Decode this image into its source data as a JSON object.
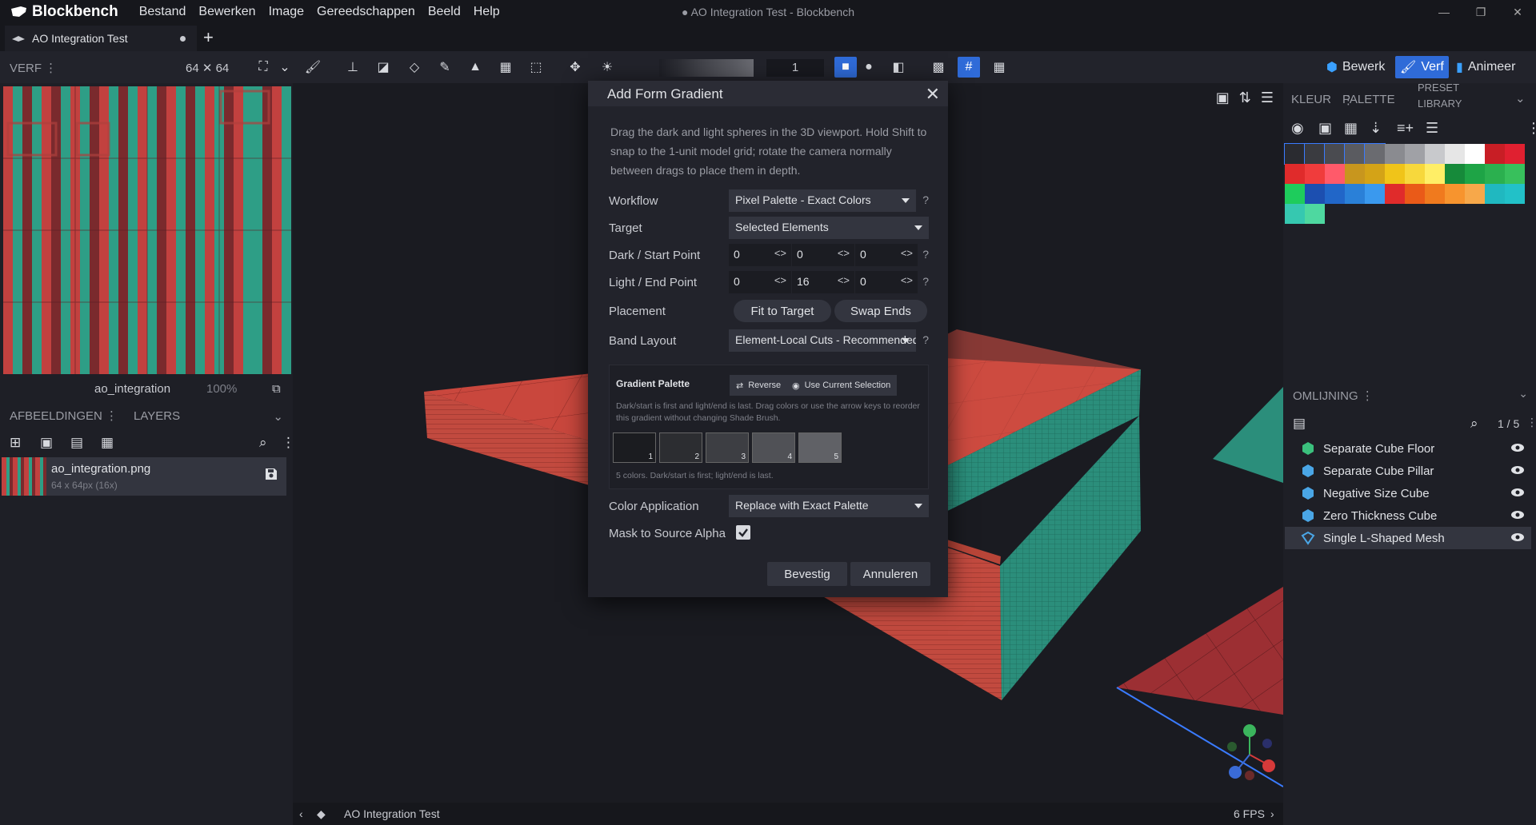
{
  "app": {
    "name": "Blockbench",
    "window_title": "AO Integration Test - Blockbench",
    "menu": [
      "Bestand",
      "Bewerken",
      "Image",
      "Gereedschappen",
      "Beeld",
      "Help"
    ]
  },
  "tabs": [
    {
      "label": "AO Integration Test"
    }
  ],
  "toolbar": {
    "mode_label": "VERF",
    "canvas_size": "64 ✕ 64",
    "brush_size": "1",
    "modes": [
      "Bewerk",
      "Verf",
      "Animeer"
    ]
  },
  "texture_preview": {
    "name": "ao_integration",
    "zoom": "100%"
  },
  "images_panel": {
    "tabs": [
      "AFBEELDINGEN",
      "LAYERS"
    ],
    "items": [
      {
        "name": "ao_integration.png",
        "sub": "64 x 64px (16x)"
      }
    ]
  },
  "dialog": {
    "title": "Add Form Gradient",
    "description": "Drag the dark and light spheres in the 3D viewport. Hold Shift to snap to the 1-unit model grid; rotate the camera normally between drags to place them in depth.",
    "workflow": {
      "label": "Workflow",
      "value": "Pixel Palette - Exact Colors"
    },
    "target": {
      "label": "Target",
      "value": "Selected Elements"
    },
    "dark_point": {
      "label": "Dark / Start Point",
      "x": "0",
      "y": "0",
      "z": "0"
    },
    "light_point": {
      "label": "Light / End Point",
      "x": "0",
      "y": "16",
      "z": "0"
    },
    "placement": {
      "label": "Placement",
      "fit": "Fit to Target",
      "swap": "Swap Ends"
    },
    "band_layout": {
      "label": "Band Layout",
      "value": "Element-Local Cuts - Recommended"
    },
    "gradient_palette": {
      "title": "Gradient Palette",
      "reverse": "Reverse",
      "use_selection": "Use Current Selection",
      "description": "Dark/start is first and light/end is last. Drag colors or use the arrow keys to reorder this gradient without changing Shade Brush.",
      "stops": [
        {
          "index": "1",
          "color": "#1b1c20"
        },
        {
          "index": "2",
          "color": "#2c2d31"
        },
        {
          "index": "3",
          "color": "#3d3e43"
        },
        {
          "index": "4",
          "color": "#505156"
        },
        {
          "index": "5",
          "color": "#606166"
        }
      ],
      "footer": "5 colors. Dark/start is first; light/end is last."
    },
    "color_application": {
      "label": "Color Application",
      "value": "Replace with Exact Palette"
    },
    "mask": {
      "label": "Mask to Source Alpha",
      "checked": true
    },
    "confirm": "Bevestig",
    "cancel": "Annuleren"
  },
  "viewport": {
    "footer_title": "AO Integration Test",
    "fps": "6 FPS"
  },
  "palette_panel": {
    "tabs": [
      "KLEUR",
      "PALETTE",
      "PRESET LIBRARY"
    ],
    "swatches": [
      "#2a2b30",
      "#3a3b40",
      "#4a4b50",
      "#5a5b60",
      "#6a6b70",
      "#8a8b90",
      "#a0a1a6",
      "#c8c9cc",
      "#e6e6e6",
      "#ffffff",
      "#c81e25",
      "#e02030",
      "#e02b2b",
      "#f03c3c",
      "#ff5a6a",
      "#c8961e",
      "#d4a317",
      "#f0c419",
      "#f7d83c",
      "#ffee66",
      "#168a3a",
      "#1ea446",
      "#2bb04f",
      "#38c05c",
      "#1ecc5c",
      "#1c4fb0",
      "#2166c8",
      "#2a80d8",
      "#3a99ee",
      "#e02b2b",
      "#ea5a18",
      "#f07a1e",
      "#f7942e",
      "#f7a84a",
      "#20b8c0",
      "#22c1c8",
      "#36c8b0",
      "#4ed8a0"
    ]
  },
  "outliner": {
    "title": "OMLIJNING",
    "count": "1 / 5",
    "items": [
      {
        "name": "Separate Cube Floor",
        "type": "cube"
      },
      {
        "name": "Separate Cube Pillar",
        "type": "cube"
      },
      {
        "name": "Negative Size Cube",
        "type": "cube"
      },
      {
        "name": "Zero Thickness Cube",
        "type": "cube"
      },
      {
        "name": "Single L-Shaped Mesh",
        "type": "mesh",
        "selected": true
      }
    ]
  }
}
